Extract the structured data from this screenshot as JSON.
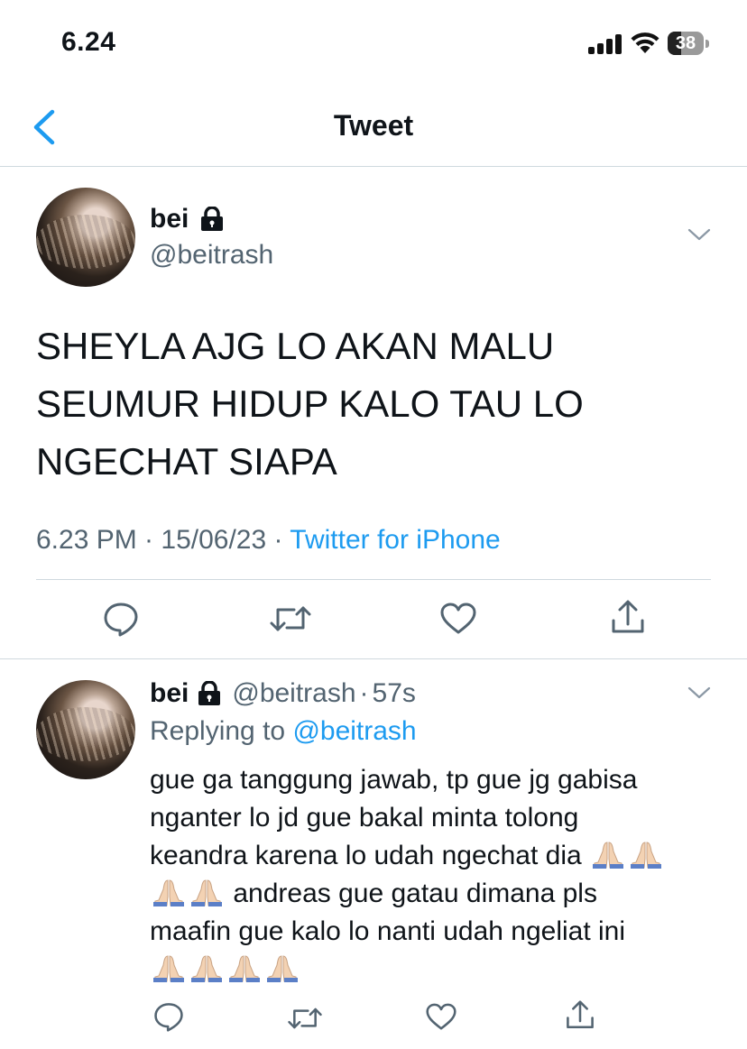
{
  "status_bar": {
    "time": "6.24",
    "battery": "38",
    "battery_level": 0.38
  },
  "nav": {
    "title": "Tweet"
  },
  "tweet": {
    "name": "bei",
    "handle": "@beitrash",
    "text_lines": [
      "SHEYLA AJG LO AKAN MALU",
      "SEUMUR HIDUP KALO TAU LO",
      "NGECHAT SIAPA"
    ],
    "meta_time": "6.23 PM · 15/06/23 · ",
    "meta_source": "Twitter for iPhone"
  },
  "reply": {
    "name": "bei",
    "handle": "@beitrash",
    "dot": "·",
    "time": "57s",
    "replying_prefix": "Replying to ",
    "replying_to": "@beitrash",
    "line1": "gue ga tanggung jawab, tp gue jg gabisa",
    "line2": "nganter lo jd gue bakal minta tolong",
    "line3": "keandra karena lo udah ngechat dia",
    "line4": "andreas gue gatau dimana pls",
    "line5": "maafin gue kalo lo nanti udah ngeliat ini"
  },
  "icons": {
    "back": "chevron-left-icon",
    "lock": "lock-icon",
    "chevron": "chevron-down-icon",
    "reply": "comment-icon",
    "retweet": "retweet-icon",
    "like": "heart-icon",
    "share": "share-icon",
    "emoji": "folded-hands-emoji"
  },
  "colors": {
    "accent": "#1d9bf0",
    "secondary_text": "#536471",
    "divider": "#cfd9de"
  }
}
